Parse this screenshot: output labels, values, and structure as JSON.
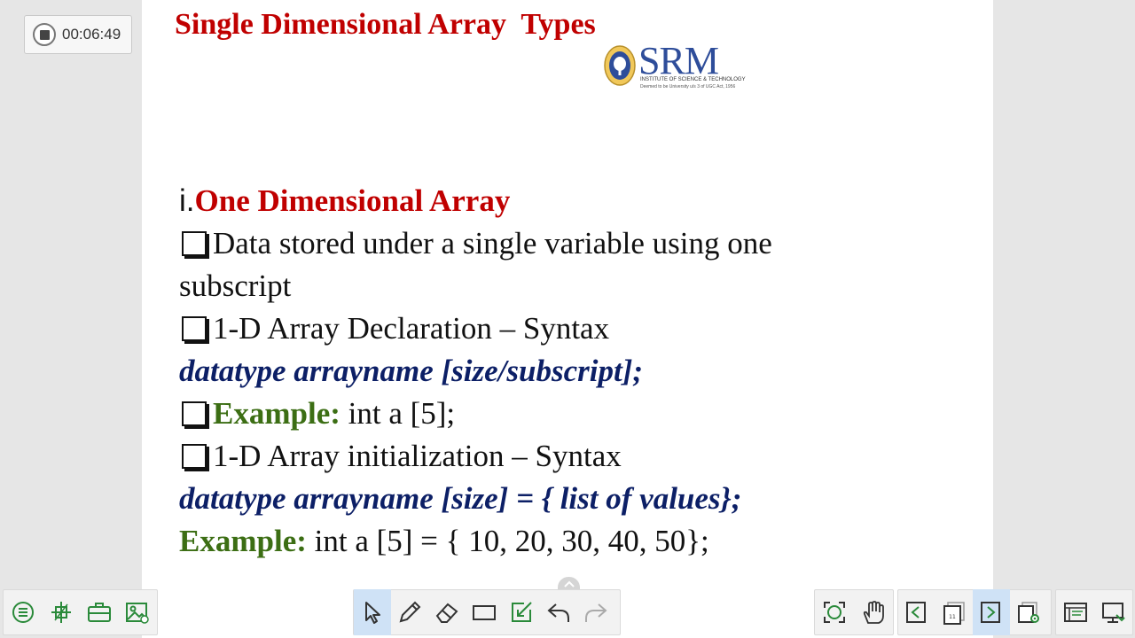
{
  "recorder": {
    "time": "00:06:49",
    "stop_icon": "stop-icon"
  },
  "slide": {
    "title": "Single Dimensional Array  Types",
    "logo": {
      "name": "SRM",
      "subtitle": "INSTITUTE OF SCIENCE & TECHNOLOGY",
      "tagline": "Deemed to be University u/s 3 of UGC Act, 1956"
    },
    "heading_numeral": "i.",
    "heading": "One Dimensional Array",
    "bullet1": "Data stored under a single variable using one",
    "bullet1_cont": "subscript",
    "bullet2": "1-D Array Declaration – Syntax",
    "syntax1": "datatype arrayname [size/subscript];",
    "example_label": "Example:",
    "example1_code": " int a [5];",
    "bullet3": "1-D Array initialization – Syntax",
    "syntax2": "datatype arrayname [size] = { list of values};",
    "example2_code": " int a [5] = { 10, 20, 30, 40, 50};"
  },
  "toolbar": {
    "left": [
      "menu-icon",
      "add-slide-icon",
      "toolbox-icon",
      "image-icon"
    ],
    "center": [
      "select-icon",
      "pen-icon",
      "eraser-icon",
      "rectangle-icon",
      "annotate-icon",
      "undo-icon",
      "redo-icon"
    ],
    "right_a": [
      "zoom-fit-icon",
      "hand-roam-icon"
    ],
    "right_b": [
      "prev-page-icon",
      "page-counter-icon",
      "next-page-icon",
      "page-settings-icon"
    ],
    "right_c": [
      "board-icon",
      "screen-icon"
    ],
    "page_number": "11",
    "active_color": "#cfe2f6"
  },
  "colors": {
    "title": "#c00000",
    "heading": "#c00000",
    "syntax": "#0c1f66",
    "example": "#3c6e14"
  }
}
